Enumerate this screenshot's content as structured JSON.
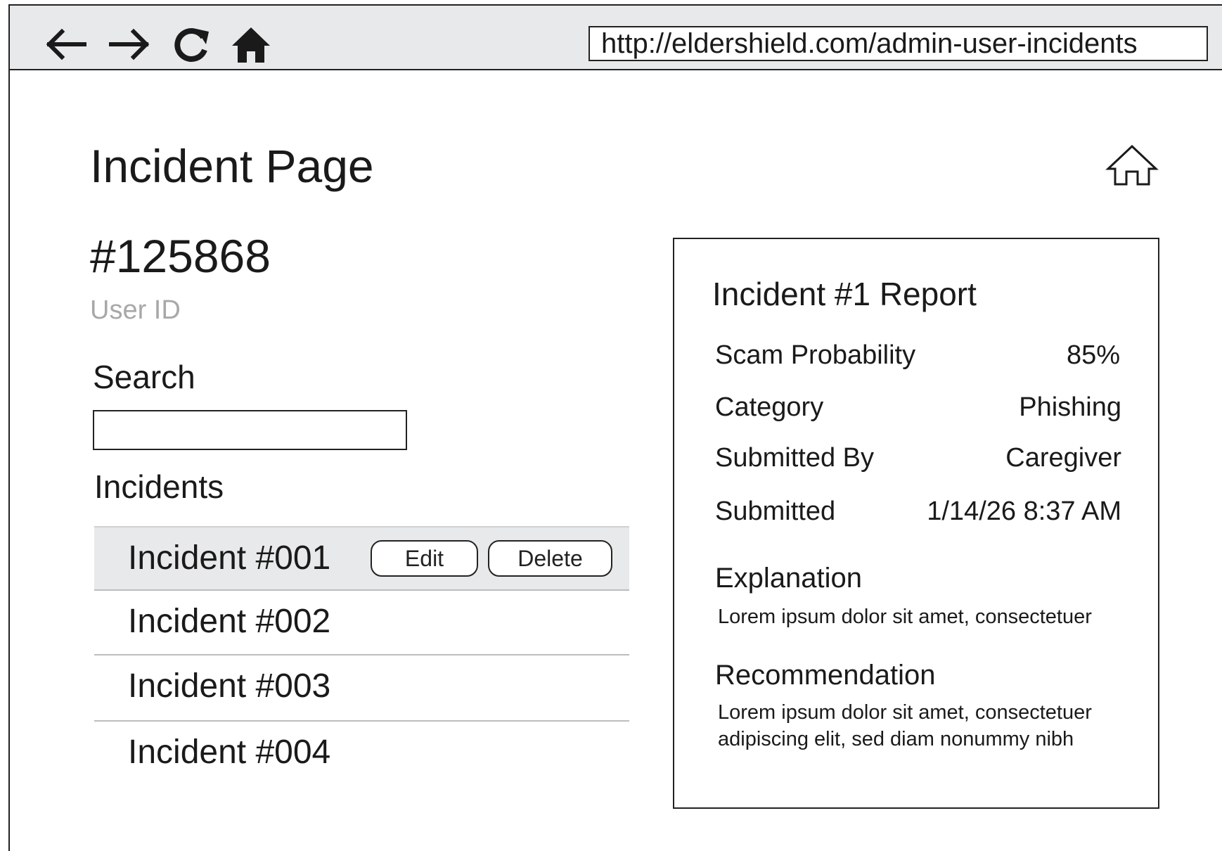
{
  "browser": {
    "url": "http://eldershield.com/admin-user-incidents",
    "nav": [
      "back-arrow-icon",
      "forward-arrow-icon",
      "reload-icon",
      "home-solid-icon"
    ]
  },
  "page": {
    "title": "Incident Page",
    "home_icon": "home-outline-icon"
  },
  "user": {
    "id_value": "#125868",
    "id_label": "User ID"
  },
  "search": {
    "label": "Search",
    "value": "",
    "placeholder": ""
  },
  "incidents": {
    "heading": "Incidents",
    "items": [
      {
        "name": "Incident #001",
        "selected": true
      },
      {
        "name": "Incident #002",
        "selected": false
      },
      {
        "name": "Incident #003",
        "selected": false
      },
      {
        "name": "Incident #004",
        "selected": false
      }
    ],
    "edit_label": "Edit",
    "delete_label": "Delete"
  },
  "report": {
    "title": "Incident #1 Report",
    "fields": [
      {
        "label": "Scam Probability",
        "value": "85%"
      },
      {
        "label": "Category",
        "value": "Phishing"
      },
      {
        "label": "Submitted By",
        "value": "Caregiver"
      },
      {
        "label": "Submitted",
        "value": "1/14/26 8:37 AM"
      }
    ],
    "explanation_heading": "Explanation",
    "explanation_text": "Lorem ipsum dolor sit amet, consectetuer",
    "recommendation_heading": "Recommendation",
    "recommendation_text": "Lorem ipsum dolor sit amet, consectetuer adipiscing elit, sed diam nonummy nibh"
  },
  "colors": {
    "chrome_bg": "#e8e9ea",
    "selected_row_bg": "#e8e9ea",
    "muted_text": "#a8a8a8",
    "border": "#222222"
  }
}
